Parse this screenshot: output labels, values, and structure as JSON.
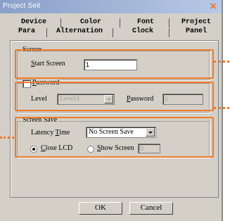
{
  "window": {
    "title": "Project Seit",
    "close_glyph": "×",
    "accent_color": "#f07a28"
  },
  "tabs_row1": [
    "Device",
    "Color",
    "Font",
    "Project"
  ],
  "tabs_row2": [
    "Para",
    "Alternation",
    "Clock",
    "Panel"
  ],
  "screen_group": {
    "legend": "Screen",
    "start_screen_label_u": "S",
    "start_screen_label_rest": "tart Screen",
    "start_screen_value": "1"
  },
  "password_group": {
    "checkbox_label_u": "P",
    "checkbox_label_rest": "assword",
    "level_label": "Level",
    "level_value": "Level3",
    "password_label_u": "P",
    "password_label_rest": "assword",
    "password_value": "0"
  },
  "screensave_group": {
    "legend": "Screen Save",
    "latency_label_pre": "Latency ",
    "latency_label_u": "T",
    "latency_label_rest": "ime",
    "latency_value": "No Screen Save",
    "close_lcd_label_u": "C",
    "close_lcd_label_rest": "lose LCD",
    "show_screen_label_u": "S",
    "show_screen_label_rest": "how Screen",
    "show_screen_value": "0"
  },
  "buttons": {
    "ok": "OK",
    "cancel": "Cancel"
  }
}
